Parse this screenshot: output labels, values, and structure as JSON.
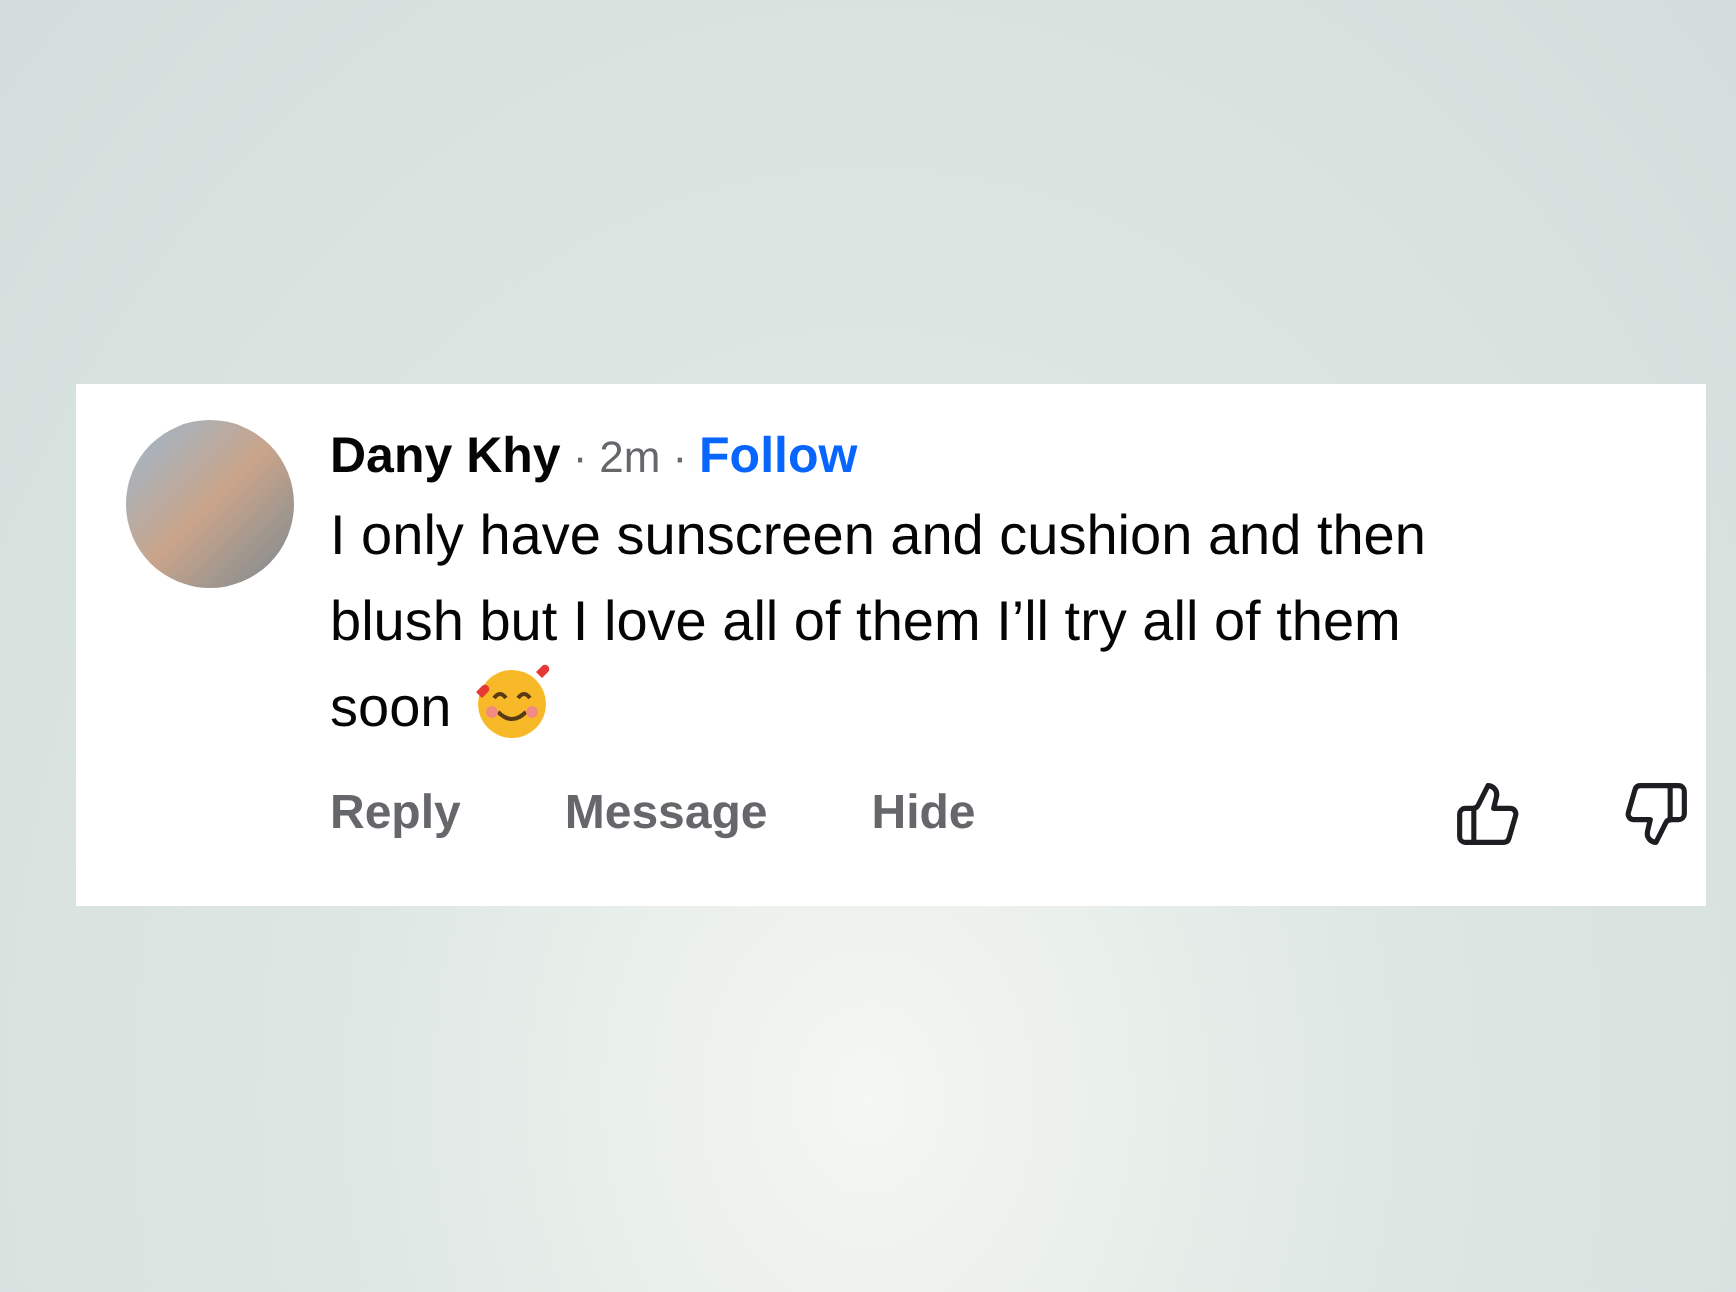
{
  "comment": {
    "author": "Dany Khy",
    "separator_1": "·",
    "time": "2m",
    "separator_2": "·",
    "follow": "Follow",
    "text": "I only have sunscreen and cushion and then blush but I love all of them I’ll try all of them",
    "text_last_line": "soon"
  },
  "actions": [
    "Reply",
    "Message",
    "Hide"
  ]
}
